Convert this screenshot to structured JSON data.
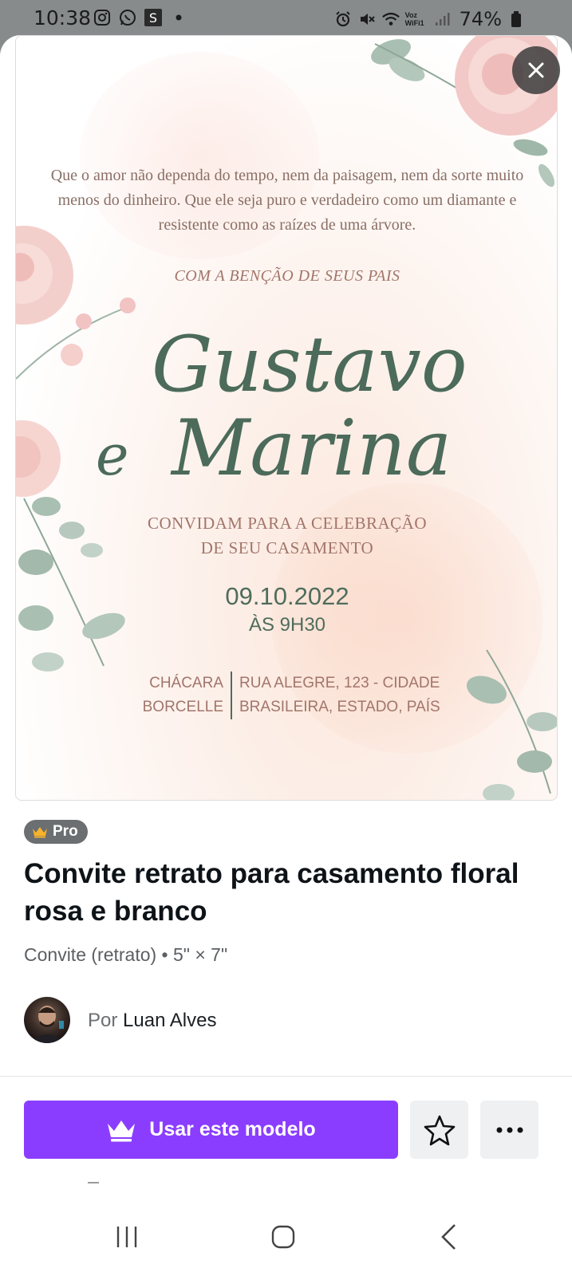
{
  "status_bar": {
    "time": "10:38",
    "battery": "74%",
    "network": "Voz WiFi1"
  },
  "template": {
    "quote": "Que o amor não dependa do tempo, nem da paisagem, nem da sorte muito menos do dinheiro. Que ele seja puro e verdadeiro como um diamante e resistente como as raízes de uma árvore.",
    "blessing": "COM A BENÇÃO DE SEUS PAIS",
    "name1": "Gustavo",
    "conjunction": "e",
    "name2": "Marina",
    "invite_line1": "CONVIDAM PARA A CELEBRAÇÃO",
    "invite_line2": "DE SEU CASAMENTO",
    "date": "09.10.2022",
    "time": "ÀS 9H30",
    "venue_line1": "CHÁCARA",
    "venue_line2": "BORCELLE",
    "address_line1": "RUA ALEGRE, 123 - CIDADE",
    "address_line2": "BRASILEIRA, ESTADO, PAÍS"
  },
  "details": {
    "badge": "Pro",
    "title": "Convite retrato para casamento floral rosa e branco",
    "meta": "Convite (retrato) • 5\" × 7\"",
    "author_prefix": "Por",
    "author_name": "Luan Alves"
  },
  "actions": {
    "use_template": "Usar este modelo"
  },
  "colors": {
    "primary": "#8b3dff",
    "script_green": "#4c6b5a",
    "rose_text": "#a2756a"
  }
}
